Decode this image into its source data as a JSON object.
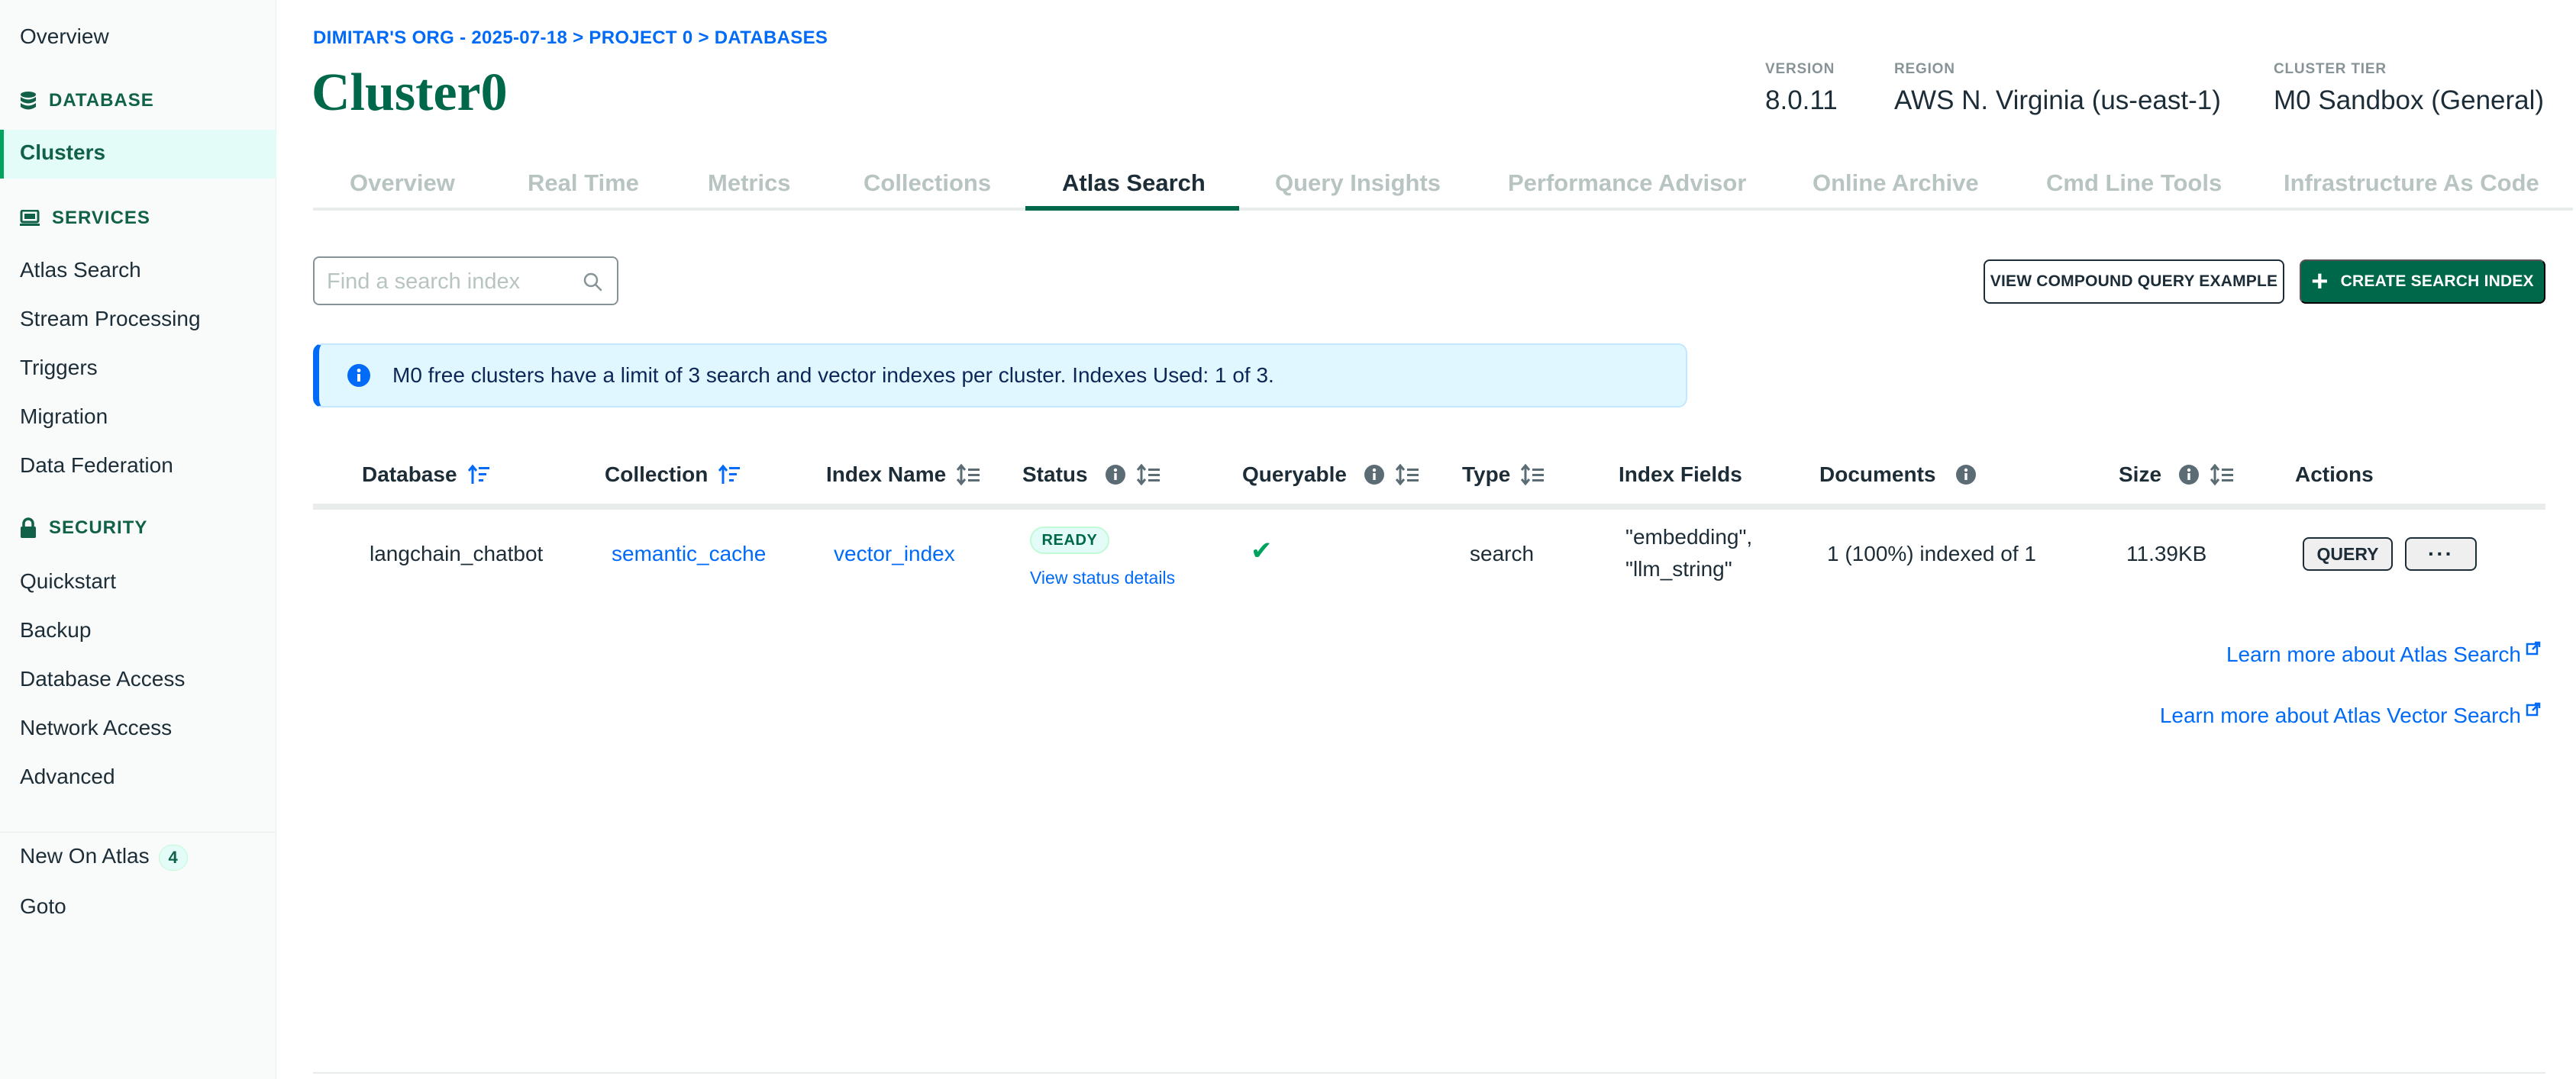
{
  "sidebar": {
    "overview": "Overview",
    "database_heading": "DATABASE",
    "clusters": "Clusters",
    "services_heading": "SERVICES",
    "services": [
      "Atlas Search",
      "Stream Processing",
      "Triggers",
      "Migration",
      "Data Federation"
    ],
    "security_heading": "SECURITY",
    "security": [
      "Quickstart",
      "Backup",
      "Database Access",
      "Network Access",
      "Advanced"
    ],
    "new_on_atlas": "New On Atlas",
    "new_on_atlas_count": "4",
    "goto": "Goto"
  },
  "header": {
    "breadcrumb": "DIMITAR'S ORG - 2025-07-18 > PROJECT 0 > DATABASES",
    "title": "Cluster0",
    "version_label": "VERSION",
    "version_value": "8.0.11",
    "region_label": "REGION",
    "region_value": "AWS N. Virginia (us-east-1)",
    "tier_label": "CLUSTER TIER",
    "tier_value": "M0 Sandbox (General)"
  },
  "tabs": [
    "Overview",
    "Real Time",
    "Metrics",
    "Collections",
    "Atlas Search",
    "Query Insights",
    "Performance Advisor",
    "Online Archive",
    "Cmd Line Tools",
    "Infrastructure As Code"
  ],
  "active_tab": "Atlas Search",
  "toolbar": {
    "search_placeholder": "Find a search index",
    "compound_button": "VIEW COMPOUND QUERY EXAMPLE",
    "create_button": "CREATE SEARCH INDEX"
  },
  "banner": {
    "text": "M0 free clusters have a limit of 3 search and vector indexes per cluster. Indexes Used: 1 of 3."
  },
  "table": {
    "columns": {
      "database": "Database",
      "collection": "Collection",
      "index_name": "Index Name",
      "status": "Status",
      "queryable": "Queryable",
      "type": "Type",
      "index_fields": "Index Fields",
      "documents": "Documents",
      "size": "Size",
      "actions": "Actions"
    },
    "rows": [
      {
        "database": "langchain_chatbot",
        "collection": "semantic_cache",
        "index_name": "vector_index",
        "status": "READY",
        "status_link": "View status details",
        "queryable": "✔",
        "type": "search",
        "index_fields_1": "\"embedding\",",
        "index_fields_2": "\"llm_string\"",
        "documents": "1 (100%) indexed of 1",
        "size": "11.39KB",
        "query_button": "QUERY",
        "more_button": "···"
      }
    ]
  },
  "links": {
    "learn_search": "Learn more about Atlas Search",
    "learn_vector": "Learn more about Atlas Vector Search"
  },
  "colors": {
    "accent_green": "#00684a",
    "link_blue": "#016bf8",
    "banner_bg": "#e1f7ff"
  }
}
